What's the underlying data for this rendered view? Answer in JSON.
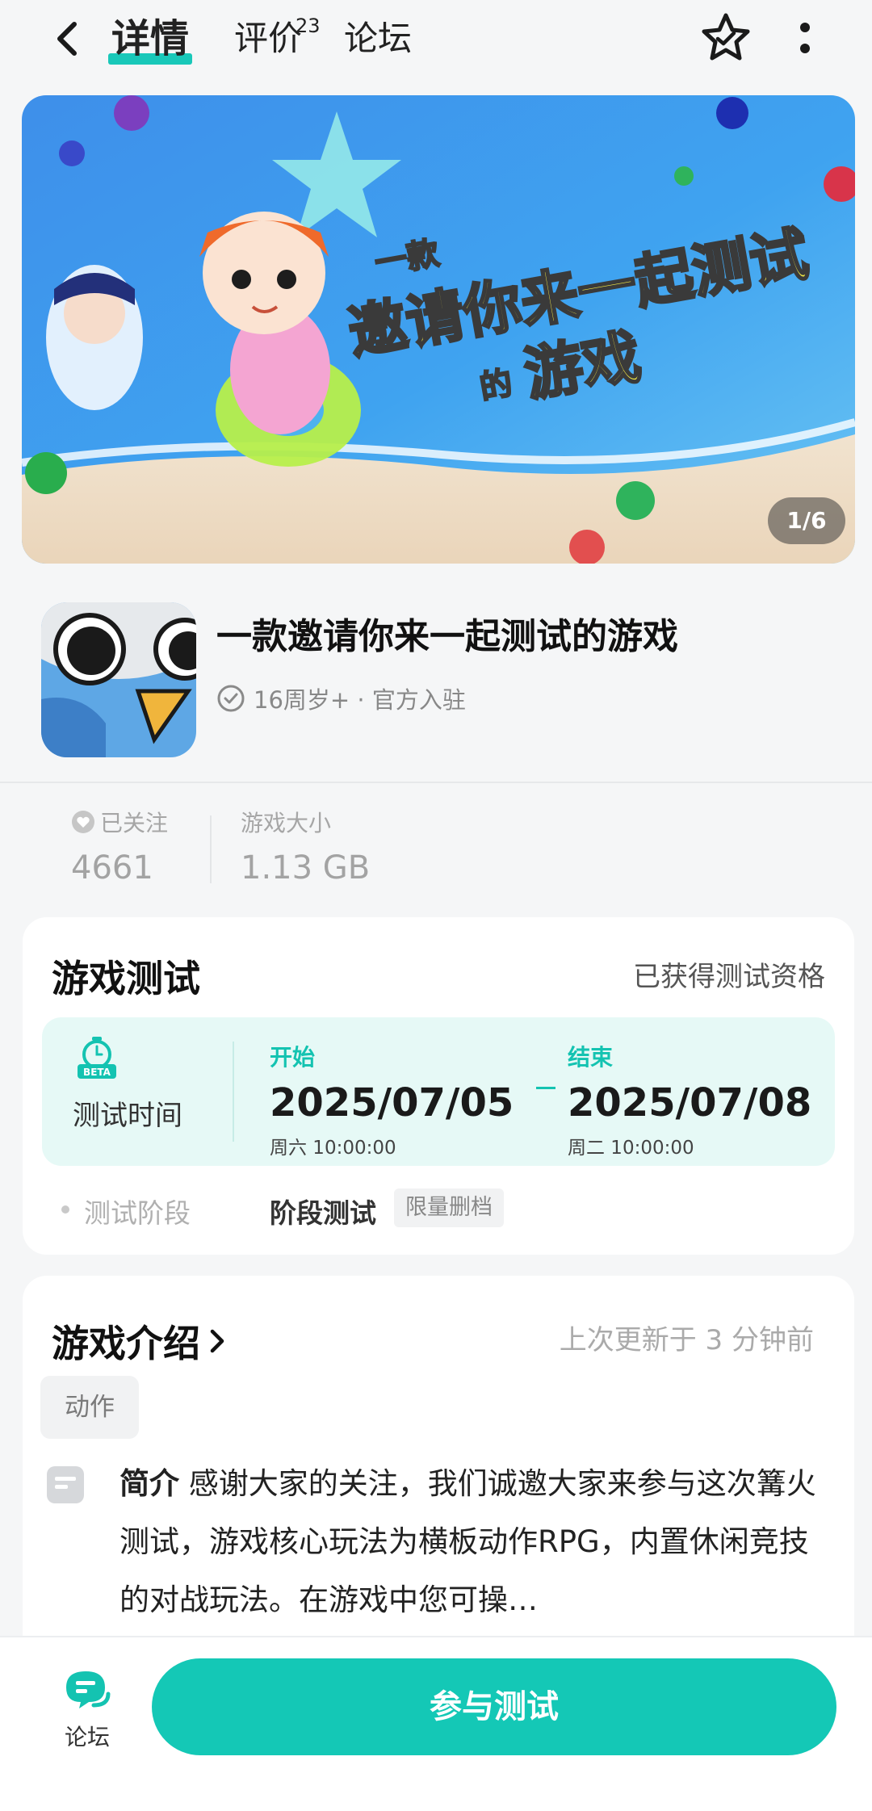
{
  "nav": {
    "tabs": [
      {
        "label": "详情",
        "active": true
      },
      {
        "label": "评价",
        "badge": "23"
      },
      {
        "label": "论坛"
      }
    ],
    "icons": [
      "back-arrow-icon",
      "favorite-star-icon",
      "more-vertical-icon"
    ]
  },
  "banner": {
    "headline_small": "一款",
    "headline_main": "邀请你来一起测试",
    "headline_tail_small": "的",
    "headline_tail": "游戏",
    "counter": "1/6"
  },
  "app": {
    "title": "一款邀请你来一起测试的游戏",
    "meta": "16周岁+ · 官方入驻"
  },
  "stats": {
    "follow_label": "已关注",
    "follow_value": "4661",
    "size_label": "游戏大小",
    "size_value": "1.13 GB"
  },
  "test": {
    "title": "游戏测试",
    "status": "已获得测试资格",
    "badge_icon_text": "BETA",
    "time_label": "测试时间",
    "start_tag": "开始",
    "start_date": "2025/07/05",
    "start_time": "周六  10:00:00",
    "end_tag": "结束",
    "end_date": "2025/07/08",
    "end_time": "周二  10:00:00",
    "phase_label": "测试阶段",
    "phase_value": "阶段测试",
    "phase_badge": "限量删档"
  },
  "intro": {
    "title": "游戏介绍",
    "updated": "上次更新于 3 分钟前",
    "genre": "动作",
    "summary_label": "简介",
    "summary_text": " 感谢大家的关注，我们诚邀大家来参与这次篝火测试，游戏核心玩法为横板动作RPG，内置休闲竞技的对战玩法。在游戏中您可操…"
  },
  "bottom": {
    "forum_label": "论坛",
    "join_label": "参与测试"
  },
  "colors": {
    "accent": "#14c8b6",
    "accent_light": "#e6f9f6",
    "background": "#f5f6f7"
  }
}
